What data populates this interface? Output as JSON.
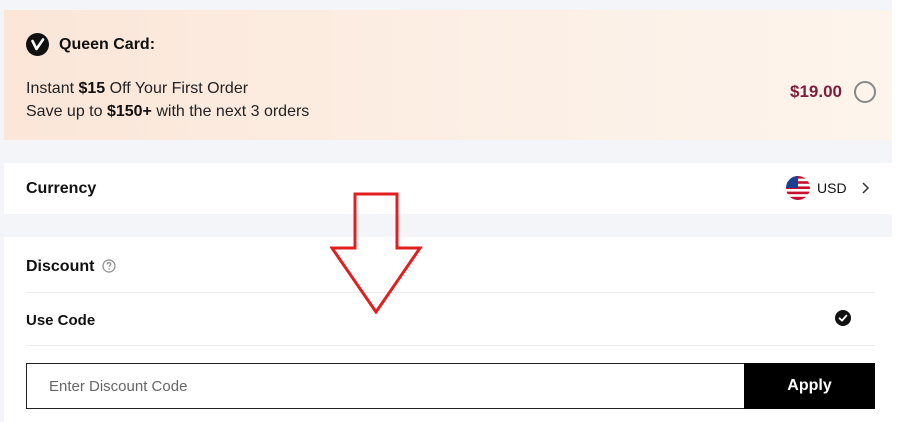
{
  "queen_card": {
    "title": "Queen Card:",
    "line1_prefix": "Instant ",
    "line1_bold": "$15",
    "line1_suffix": " Off Your First Order",
    "line2_prefix": "Save up to ",
    "line2_bold": "$150+",
    "line2_suffix": " with the next 3 orders",
    "price": "$19.00",
    "selected": false
  },
  "currency": {
    "label": "Currency",
    "code": "USD",
    "flag_icon": "us-flag-icon"
  },
  "discount": {
    "title": "Discount",
    "use_code_label": "Use Code",
    "use_code_checked": true,
    "input_value": "",
    "input_placeholder": "Enter Discount Code",
    "apply_label": "Apply"
  },
  "colors": {
    "price": "#7a1f3d",
    "annotation_arrow": "#e02020",
    "button_bg": "#000000"
  }
}
